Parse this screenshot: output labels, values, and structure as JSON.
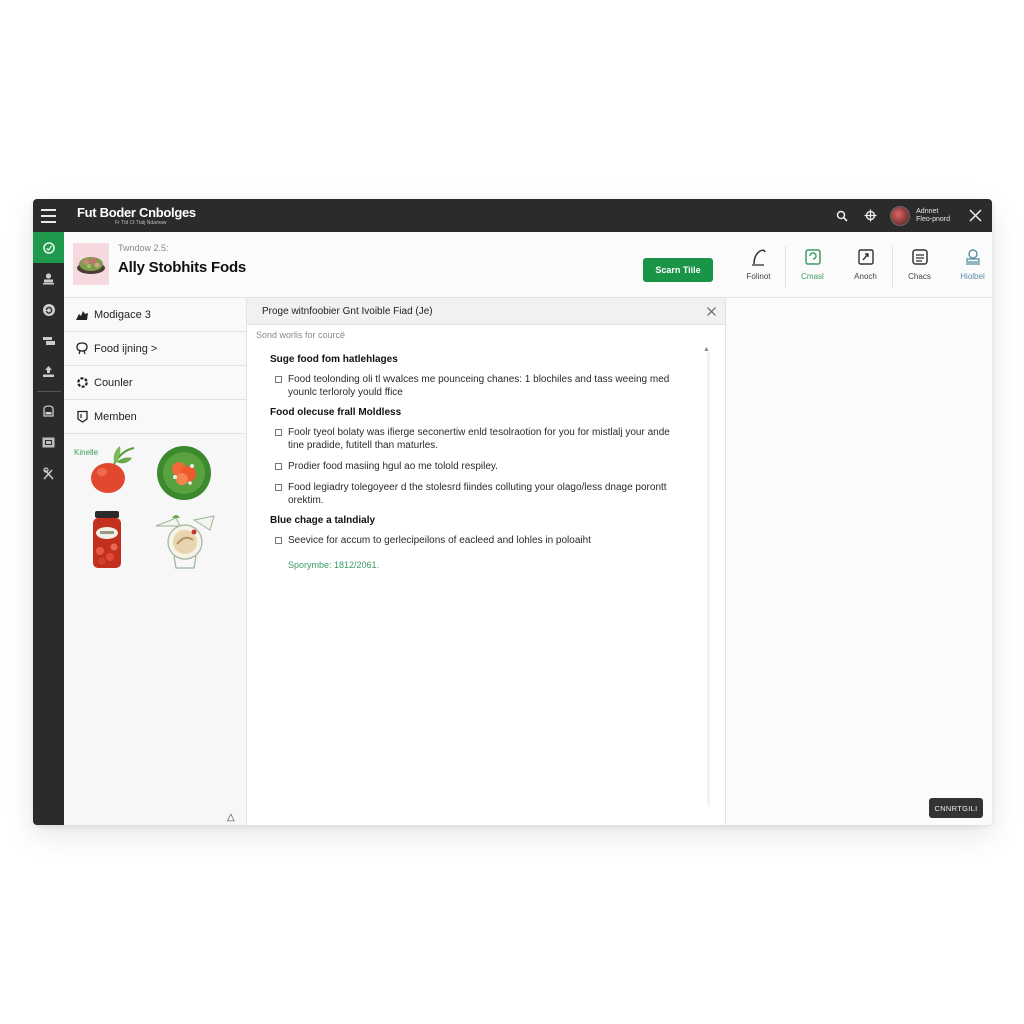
{
  "app": {
    "title": "Fut Boder Cnbolges",
    "subtitle": "Fr Ttd Ct Ttalj Ndamaw"
  },
  "topbar": {
    "icons": [
      "search-icon",
      "settings-icon"
    ],
    "user": {
      "line1": "Adnnet",
      "line2": "Fleo-pnord"
    },
    "close_icon": "close-icon"
  },
  "rail": {
    "items": [
      {
        "icon": "chat-icon",
        "active": true
      },
      {
        "icon": "user-stamp-icon",
        "active": false
      },
      {
        "icon": "sync-icon",
        "active": false
      },
      {
        "icon": "cards-icon",
        "active": false
      },
      {
        "icon": "upload-icon",
        "active": false
      },
      {
        "icon": "inbox-icon",
        "active": false
      },
      {
        "icon": "window-icon",
        "active": false
      },
      {
        "icon": "tools-icon",
        "active": false
      }
    ]
  },
  "header": {
    "subtitle": "Twndow 2.5:",
    "title": "Ally Stobhits Fods",
    "primary_button": "Scarn Tiile",
    "toolbar": [
      {
        "label": "Folinot",
        "icon": "pen-icon",
        "tone": "default"
      },
      {
        "label": "Cmasl",
        "icon": "message-icon",
        "tone": "green"
      },
      {
        "label": "Anoch",
        "icon": "attach-icon",
        "tone": "default"
      },
      {
        "label": "Chacs",
        "icon": "list-icon",
        "tone": "default"
      },
      {
        "label": "Hiolbel",
        "icon": "stamp-icon",
        "tone": "blue"
      }
    ]
  },
  "sidelist": {
    "items": [
      {
        "label": "Modigace 3",
        "icon": "squirrel-icon"
      },
      {
        "label": "Food ijning >",
        "icon": "bowl-icon"
      },
      {
        "label": "Counler",
        "icon": "gear-icon"
      },
      {
        "label": "Memben",
        "icon": "badge-icon"
      }
    ],
    "gallery_label": "Kinelle",
    "gallery": [
      "tomato-image",
      "salad-plate-image",
      "pickled-jar-image",
      "hummus-bowl-image"
    ]
  },
  "panel": {
    "title": "Proge witnfoobier Gnt Ivoible Fiad (Je)",
    "hint": "Sond worlis for courcë",
    "sections": [
      {
        "title": "Suge food fom hatlehlages",
        "items": [
          "Food teolonding oli tl wvalces me pounceing chanes: 1 blochiles and tass weeing med younlc terloroly yould ffice"
        ]
      },
      {
        "title": "Food olecuse frall Moldless",
        "items": [
          "Foolr tyeol bolaty was ifierge seconertiw enld tesolraotion for you for mistlalj your ande tine pradide, futitell than maturles.",
          "Prodier food masiing hgul ao me tolold respiley.",
          "Food legiadry tolegoyeer d the stolesrd fiindes colluting your olago/less dnage porontt orektim."
        ]
      },
      {
        "title": "Blue chage a talndialy",
        "items": [
          "Seevice for accum to gerlecipeilons of eacleed and lohles in poloaiht"
        ]
      }
    ],
    "footer_link": "Sporymbe: 1812/2061."
  },
  "bottom_button": "CNNRTGILI",
  "colors": {
    "accent": "#1a9446",
    "topbar": "#2b2b2b",
    "link_green": "#3c9b64"
  }
}
